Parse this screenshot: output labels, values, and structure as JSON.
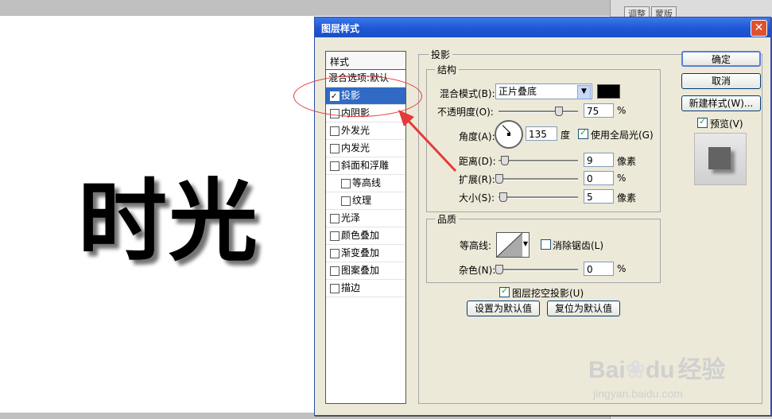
{
  "canvas": {
    "text": "时光"
  },
  "right_panel": {
    "tabs": [
      "调整",
      "蒙版"
    ]
  },
  "dialog": {
    "title": "图层样式",
    "close": "✕",
    "styles_header": "样式",
    "styles": [
      {
        "label": "混合选项:默认",
        "checkbox": false,
        "checked": false,
        "selected": false,
        "indent": false
      },
      {
        "label": "投影",
        "checkbox": true,
        "checked": true,
        "selected": true,
        "indent": false
      },
      {
        "label": "内阴影",
        "checkbox": true,
        "checked": false,
        "selected": false,
        "indent": false
      },
      {
        "label": "外发光",
        "checkbox": true,
        "checked": false,
        "selected": false,
        "indent": false
      },
      {
        "label": "内发光",
        "checkbox": true,
        "checked": false,
        "selected": false,
        "indent": false
      },
      {
        "label": "斜面和浮雕",
        "checkbox": true,
        "checked": false,
        "selected": false,
        "indent": false
      },
      {
        "label": "等高线",
        "checkbox": true,
        "checked": false,
        "selected": false,
        "indent": true
      },
      {
        "label": "纹理",
        "checkbox": true,
        "checked": false,
        "selected": false,
        "indent": true
      },
      {
        "label": "光泽",
        "checkbox": true,
        "checked": false,
        "selected": false,
        "indent": false
      },
      {
        "label": "颜色叠加",
        "checkbox": true,
        "checked": false,
        "selected": false,
        "indent": false
      },
      {
        "label": "渐变叠加",
        "checkbox": true,
        "checked": false,
        "selected": false,
        "indent": false
      },
      {
        "label": "图案叠加",
        "checkbox": true,
        "checked": false,
        "selected": false,
        "indent": false
      },
      {
        "label": "描边",
        "checkbox": true,
        "checked": false,
        "selected": false,
        "indent": false
      }
    ],
    "drop_shadow": {
      "title": "投影",
      "structure_title": "结构",
      "blend_mode_label": "混合模式(B):",
      "blend_mode_value": "正片叠底",
      "shadow_color": "#000000",
      "opacity_label": "不透明度(O):",
      "opacity_value": "75",
      "opacity_unit": "%",
      "opacity_level": 0.75,
      "angle_label": "角度(A):",
      "angle_value": "135",
      "angle_unit": "度",
      "use_global_light": "使用全局光(G)",
      "distance_label": "距离(D):",
      "distance_value": "9",
      "distance_unit": "像素",
      "spread_label": "扩展(R):",
      "spread_value": "0",
      "spread_unit": "%",
      "size_label": "大小(S):",
      "size_value": "5",
      "size_unit": "像素",
      "quality_title": "品质",
      "contour_label": "等高线:",
      "anti_alias": "消除锯齿(L)",
      "noise_label": "杂色(N):",
      "noise_value": "0",
      "noise_unit": "%",
      "knockout": "图层挖空投影(U)",
      "make_default": "设置为默认值",
      "reset_default": "复位为默认值"
    },
    "buttons": {
      "ok": "确定",
      "cancel": "取消",
      "new_style": "新建样式(W)...",
      "preview": "预览(V)"
    }
  },
  "watermark": {
    "brand": "Bai",
    "brand2": "du",
    "cn": "经验",
    "url": "jingyan.baidu.com"
  },
  "colors": {
    "accent": "#316ac5",
    "titlebar": "#1e56d6",
    "annotation": "#e53a3a"
  }
}
